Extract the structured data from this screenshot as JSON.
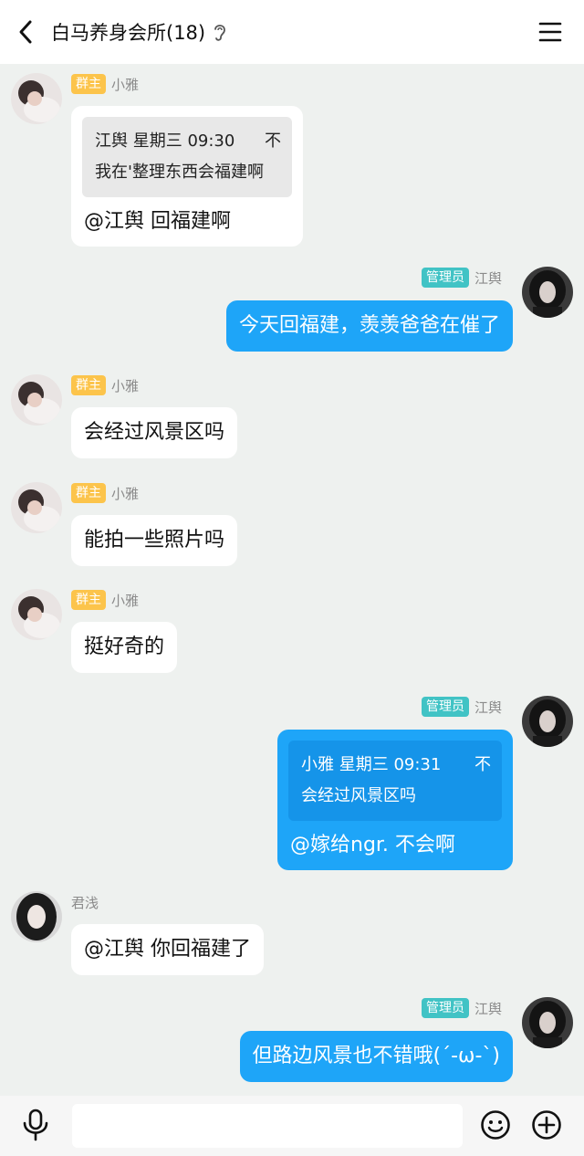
{
  "header": {
    "title": "白马养身会所(18)",
    "back_icon": "chevron-left-icon",
    "ear_icon": "ear-icon",
    "menu_icon": "hamburger-menu-icon"
  },
  "colors": {
    "owner_badge": "#fcc44b",
    "admin_badge": "#41c3c5",
    "self_bubble": "#1ea5f8",
    "background": "#eef1ef"
  },
  "messages": [
    {
      "side": "left",
      "badge": "群主",
      "name": "小雅",
      "quote": {
        "header": "江舆 星期三 09:30",
        "text": "我在'整理东西会福建啊"
      },
      "text": "@江舆 回福建啊"
    },
    {
      "side": "right",
      "badge": "管理员",
      "name": "江舆",
      "text": "今天回福建，羡羡爸爸在催了"
    },
    {
      "side": "left",
      "badge": "群主",
      "name": "小雅",
      "text": "会经过风景区吗"
    },
    {
      "side": "left",
      "badge": "群主",
      "name": "小雅",
      "text": "能拍一些照片吗"
    },
    {
      "side": "left",
      "badge": "群主",
      "name": "小雅",
      "text": "挺好奇的"
    },
    {
      "side": "right",
      "badge": "管理员",
      "name": "江舆",
      "quote": {
        "header": "小雅 星期三 09:31",
        "text": "会经过风景区吗"
      },
      "text": "@嫁给ngr. 不会啊"
    },
    {
      "side": "left",
      "badge": "",
      "name": "君浅",
      "text": "@江舆 你回福建了"
    },
    {
      "side": "right",
      "badge": "管理员",
      "name": "江舆",
      "text": "但路边风景也不错哦(´-ω-`)"
    }
  ],
  "quote_pin_glyph": "不",
  "bottombar": {
    "voice_icon": "microphone-icon",
    "emoji_icon": "smiley-icon",
    "more_icon": "plus-circle-icon",
    "input_placeholder": ""
  }
}
